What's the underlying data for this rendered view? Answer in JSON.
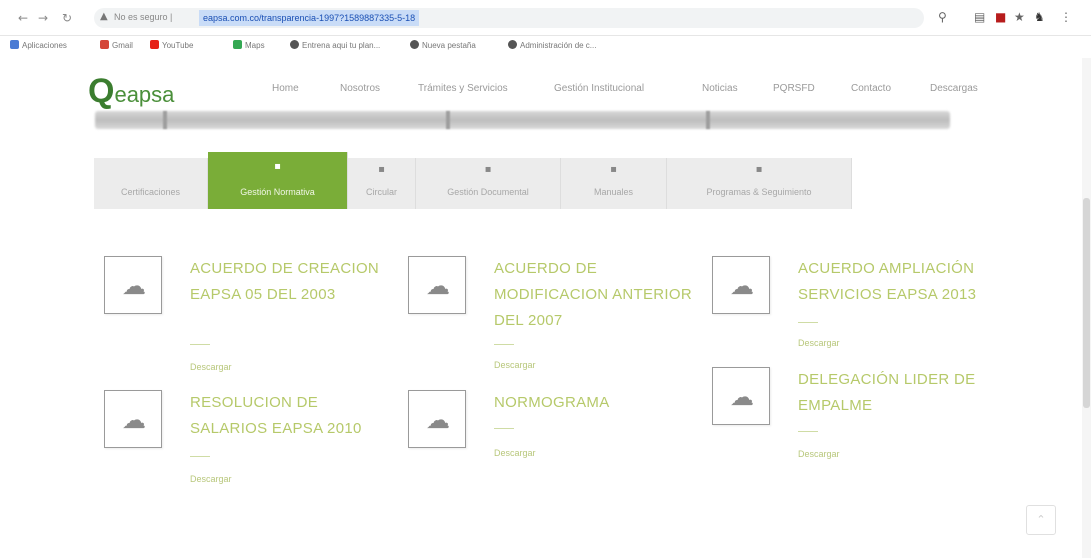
{
  "browser": {
    "back_icon": "back-arrow-icon",
    "forward_icon": "forward-arrow-icon",
    "reload_icon": "reload-icon",
    "not_secure_label": "No es seguro |",
    "url": "eapsa.com.co/transparencia-1997?1589887335-5-18",
    "bookmarks": [
      {
        "label": "Aplicaciones",
        "color": "#4a7bd4"
      },
      {
        "label": "Gmail",
        "color": "#d44638"
      },
      {
        "label": "YouTube",
        "color": "#e62117"
      },
      {
        "label": "Maps",
        "color": "#34a853"
      },
      {
        "label": "Entrena aqui tu plan...",
        "color": "#555555"
      },
      {
        "label": "Nueva pestaña",
        "color": "#555555"
      },
      {
        "label": "Administración de c...",
        "color": "#555555"
      }
    ]
  },
  "site": {
    "logo_q": "Q",
    "logo_rest": "eapsa",
    "menu": [
      "Home",
      "Nosotros",
      "Trámites y Servicios",
      "Gestión Institucional",
      "Noticias",
      "PQRSFD",
      "Contacto",
      "Descargas"
    ]
  },
  "tabs": [
    {
      "label": "Certificaciones",
      "icon": "document-icon",
      "active": false
    },
    {
      "label": "Gestión Normativa",
      "icon": "document-icon",
      "active": true
    },
    {
      "label": "Circular",
      "icon": "document-icon",
      "active": false
    },
    {
      "label": "Gestión Documental",
      "icon": "document-icon",
      "active": false
    },
    {
      "label": "Manuales",
      "icon": "document-icon",
      "active": false
    },
    {
      "label": "Programas & Seguimiento",
      "icon": "document-icon",
      "active": false
    }
  ],
  "documents": [
    {
      "title": "ACUERDO DE CREACION EAPSA 05 DEL 2003",
      "download": "Descargar"
    },
    {
      "title": "ACUERDO DE MODIFICACION ANTERIOR DEL 2007",
      "download": "Descargar"
    },
    {
      "title": "ACUERDO AMPLIACIÓN SERVICIOS EAPSA 2013",
      "download": "Descargar"
    },
    {
      "title": "RESOLUCION DE SALARIOS EAPSA 2010",
      "download": "Descargar"
    },
    {
      "title": "NORMOGRAMA",
      "download": "Descargar"
    },
    {
      "title": "DELEGACIÓN LIDER DE EMPALME",
      "download": "Descargar"
    }
  ],
  "colors": {
    "accent": "#7aad38",
    "title_green": "#b6c96a"
  }
}
